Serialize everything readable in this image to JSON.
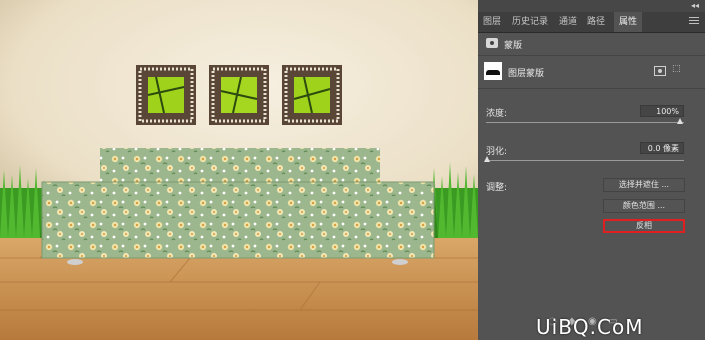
{
  "panel": {
    "tabs": [
      {
        "label": "图层"
      },
      {
        "label": "历史记录"
      },
      {
        "label": "通道"
      },
      {
        "label": "路径"
      },
      {
        "label": "属性"
      }
    ],
    "active_tab": "属性",
    "collapse_glyph": "◂◂",
    "section_title": "蒙版",
    "layer_mask_label": "图层蒙版",
    "density": {
      "label": "浓度:",
      "value": "100%",
      "level_percent": 100
    },
    "feather": {
      "label": "羽化:",
      "value": "0.0 像素",
      "level_percent": 0
    },
    "adjust_label": "调整:",
    "buttons": {
      "select_mask": "选择并遮住 ...",
      "color_range": "颜色范围 ...",
      "invert": "反相"
    }
  },
  "watermark": "UiBQ.CoM",
  "colors": {
    "panel_bg": "#535353",
    "tab_bar_bg": "#3e3e3e",
    "highlight_border": "#e02020",
    "wall": "#efe6d4",
    "grass": "#3a9a22",
    "sofa": "#9cb78d",
    "floor": "#cf9a5c"
  }
}
